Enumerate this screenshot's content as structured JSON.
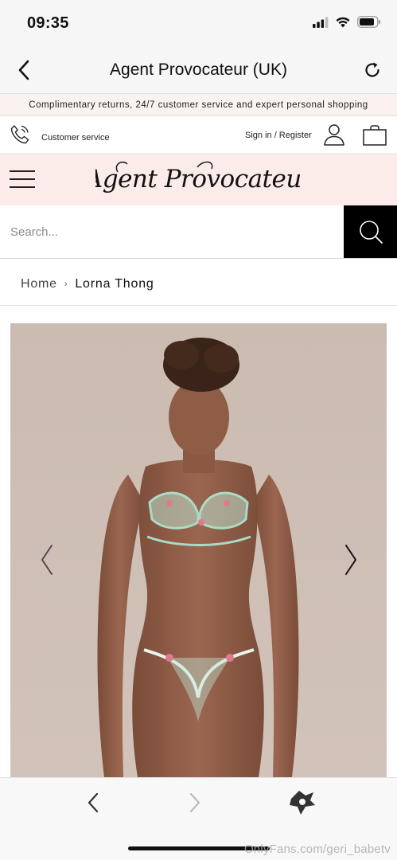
{
  "status_bar": {
    "time": "09:35"
  },
  "nav_bar": {
    "title": "Agent Provocateur (UK)"
  },
  "promo": {
    "text": "Complimentary returns, 24/7 customer service and expert personal shopping"
  },
  "utility": {
    "customer_service": "Customer service",
    "sign_in": "Sign in / Register"
  },
  "brand": {
    "logo_text": "Agent Provocateur"
  },
  "search": {
    "placeholder": "Search..."
  },
  "breadcrumb": {
    "home": "Home",
    "separator": "›",
    "current": "Lorna Thong"
  },
  "watermark": "OnlyFans.com/geri_babetv",
  "colors": {
    "promo_bg": "#faf2ee",
    "brand_bar_bg": "#fbecea",
    "search_button": "#000000",
    "photo_bg": "#cdbdb3"
  },
  "icons": [
    "back-chevron-icon",
    "reload-icon",
    "phone-icon",
    "user-icon",
    "shopping-bag-icon",
    "menu-icon",
    "search-icon",
    "carousel-prev-icon",
    "carousel-next-icon",
    "browser-back-icon",
    "browser-forward-icon",
    "open-in-app-icon"
  ]
}
